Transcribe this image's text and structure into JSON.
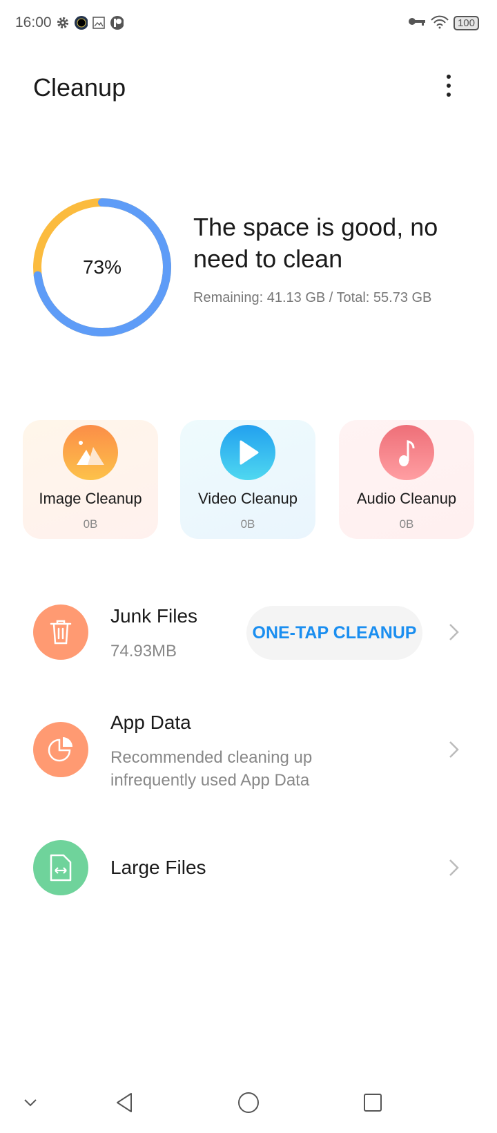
{
  "status_bar": {
    "time": "16:00",
    "battery": "100",
    "icons": [
      "gear-icon",
      "camera-lens-icon",
      "image-icon",
      "p-icon",
      "key-icon",
      "wifi-icon"
    ]
  },
  "header": {
    "title": "Cleanup",
    "more_icon": "more-vertical-icon"
  },
  "storage": {
    "percent": "73%",
    "used_fraction": 0.73,
    "headline": "The space is good, no need to clean",
    "detail": "Remaining: 41.13 GB / Total: 55.73 GB",
    "colors": {
      "used": "#5e9cf7",
      "free": "#fbbb3e"
    }
  },
  "cards": [
    {
      "label": "Image Cleanup",
      "size": "0B",
      "icon": "image-icon",
      "bg": "#fff7ee"
    },
    {
      "label": "Video Cleanup",
      "size": "0B",
      "icon": "play-icon",
      "bg": "#eef8fd"
    },
    {
      "label": "Audio Cleanup",
      "size": "0B",
      "icon": "music-note-icon",
      "bg": "#fff2f2"
    }
  ],
  "rows": [
    {
      "title": "Junk Files",
      "subtitle": "74.93MB",
      "button": "ONE-TAP CLEANUP",
      "icon": "trash-icon",
      "color": "#ff9a72"
    },
    {
      "title": "App Data",
      "subtitle": "Recommended cleaning up infrequently used App Data",
      "icon": "pie-chart-icon",
      "color": "#ff9a72"
    },
    {
      "title": "Large Files",
      "icon": "file-resize-icon",
      "color": "#6fd39b"
    }
  ],
  "accent": "#1a8ef0"
}
